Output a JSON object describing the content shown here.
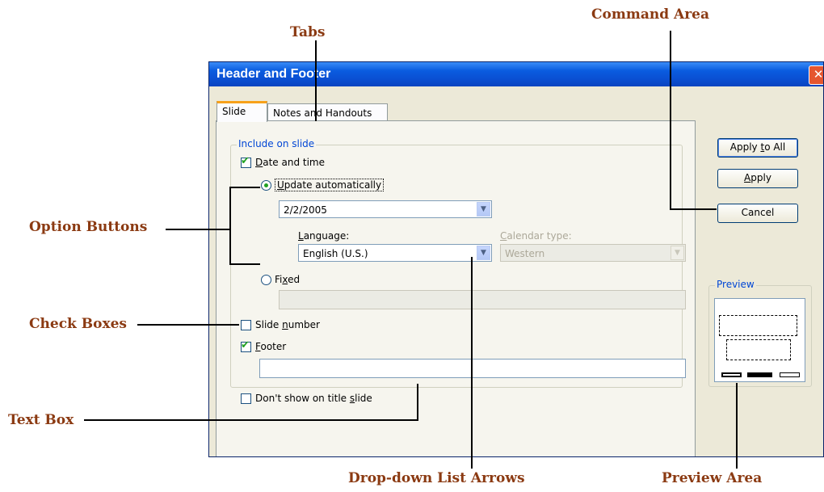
{
  "callouts": {
    "tabs": "Tabs",
    "command_area": "Command Area",
    "option_buttons": "Option Buttons",
    "check_boxes": "Check Boxes",
    "text_box": "Text Box",
    "dropdown_arrows": "Drop-down List Arrows",
    "preview_area": "Preview Area"
  },
  "dialog": {
    "title": "Header and Footer",
    "close_symbol": "✕",
    "tabs": [
      {
        "label": "Slide",
        "active": true
      },
      {
        "label": "Notes and Handouts",
        "active": false
      }
    ],
    "group_label": "Include on slide",
    "date_time": {
      "pre": "",
      "key": "D",
      "post": "ate and time",
      "checked": true
    },
    "update_auto": {
      "pre": "",
      "key": "U",
      "post": "pdate automatically",
      "selected": true
    },
    "date_value": "2/2/2005",
    "language": {
      "label_pre": "",
      "label_key": "L",
      "label_post": "anguage:",
      "value": "English (U.S.)"
    },
    "calendar": {
      "label_pre": "",
      "label_key": "C",
      "label_post": "alendar type:",
      "value": "Western",
      "enabled": false
    },
    "fixed": {
      "pre": "Fi",
      "key": "x",
      "post": "ed",
      "selected": false
    },
    "fixed_value": "",
    "slide_number": {
      "pre": "Slide ",
      "key": "n",
      "post": "umber",
      "checked": false
    },
    "footer": {
      "pre": "",
      "key": "F",
      "post": "ooter",
      "checked": true
    },
    "footer_value": "",
    "dont_show": {
      "pre": "Don't show on title ",
      "key": "s",
      "post": "lide",
      "checked": false
    },
    "buttons": {
      "apply_all": {
        "pre": "Apply ",
        "key": "t",
        "post": "o All"
      },
      "apply": {
        "pre": "",
        "key": "A",
        "post": "pply"
      },
      "cancel": "Cancel"
    },
    "preview_label": "Preview"
  },
  "icons": {
    "check": "✔",
    "arrow": "▼"
  }
}
